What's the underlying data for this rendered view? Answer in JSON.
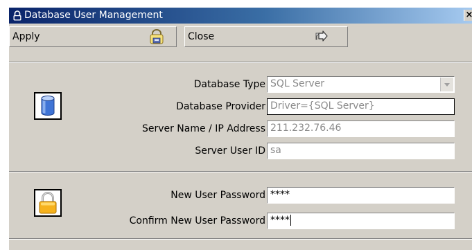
{
  "window": {
    "title": "Database User Management",
    "close_glyph": "×"
  },
  "toolbar": {
    "apply_label": "Apply",
    "apply_icon": "save-disk-icon",
    "close_label": "Close",
    "close_icon": "exit-arrow-icon"
  },
  "connection": {
    "icon": "database-cylinder-icon",
    "database_type_label": "Database Type",
    "database_type_value": "SQL Server",
    "database_provider_label": "Database Provider",
    "database_provider_value": "Driver={SQL Server}",
    "server_name_label": "Server Name / IP Address",
    "server_name_value": "211.232.76.46",
    "server_user_id_label": "Server User ID",
    "server_user_id_value": "sa"
  },
  "password": {
    "icon": "padlock-icon",
    "new_password_label": "New User Password",
    "new_password_value": "****",
    "confirm_password_label": "Confirm New User Password",
    "confirm_password_value": "****"
  },
  "colors": {
    "titlebar_start": "#0a246a",
    "titlebar_end": "#a6caf0",
    "face": "#d4d0c8",
    "disabled_text": "#8a8a8a"
  }
}
